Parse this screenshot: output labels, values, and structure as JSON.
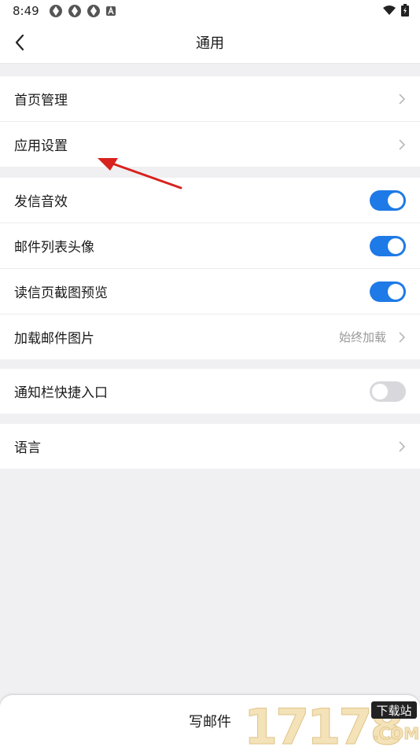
{
  "status_bar": {
    "time": "8:49",
    "notification_icons": [
      "app-icon",
      "app-icon",
      "app-icon",
      "a-icon"
    ],
    "right_icons": [
      "wifi-icon",
      "battery-icon"
    ]
  },
  "header": {
    "title": "通用",
    "back_icon": "chevron-left-icon"
  },
  "groups": [
    {
      "items": [
        {
          "label": "首页管理",
          "control": "chevron"
        },
        {
          "label": "应用设置",
          "control": "chevron"
        }
      ]
    },
    {
      "items": [
        {
          "label": "发信音效",
          "control": "toggle",
          "enabled": true
        },
        {
          "label": "邮件列表头像",
          "control": "toggle",
          "enabled": true
        },
        {
          "label": "读信页截图预览",
          "control": "toggle",
          "enabled": true
        },
        {
          "label": "加载邮件图片",
          "control": "chevron",
          "value": "始终加载"
        }
      ]
    },
    {
      "items": [
        {
          "label": "通知栏快捷入口",
          "control": "toggle",
          "enabled": false
        }
      ]
    },
    {
      "items": [
        {
          "label": "语言",
          "control": "chevron"
        }
      ]
    }
  ],
  "compose": {
    "label": "写邮件"
  },
  "colors": {
    "accent": "#1e7ae6",
    "toggle_off": "#d8d8dc",
    "annotation_arrow": "#d8221e",
    "background": "#f0f0f2"
  },
  "watermark": {
    "text": "17178",
    "subtext": "下载站",
    "suffix": ".COM"
  }
}
